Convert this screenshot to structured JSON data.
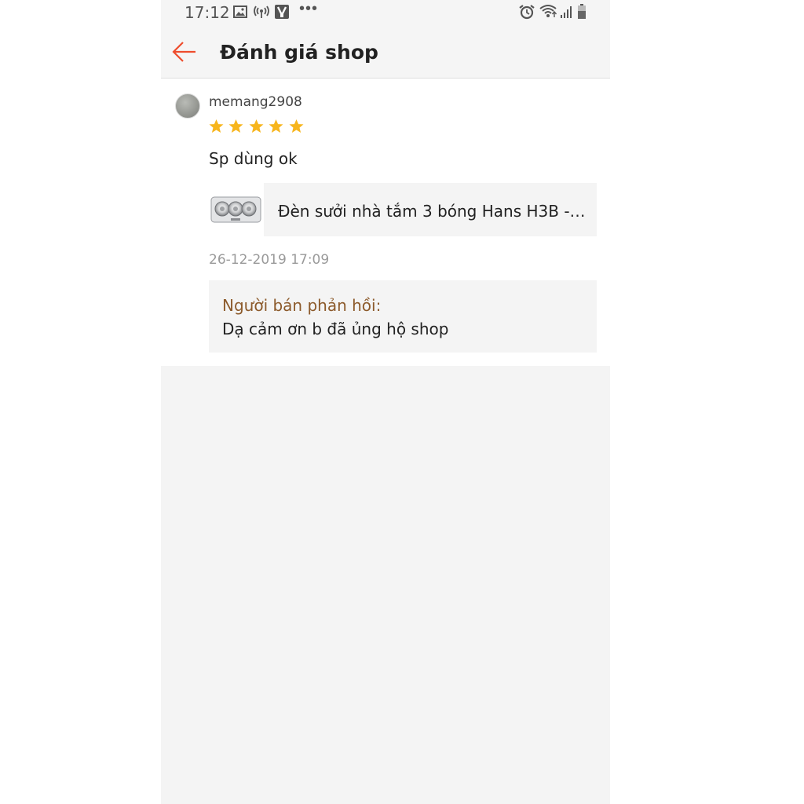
{
  "status_bar": {
    "time": "17:12",
    "left_icons": [
      "image-icon",
      "signal-broadcast-icon",
      "vpn-key-icon",
      "more-dots-icon"
    ],
    "more": "•••",
    "right_icons": [
      "alarm-icon",
      "wifi-icon",
      "cell-signal-icon",
      "battery-icon"
    ]
  },
  "header": {
    "back_icon": "arrow-left-icon",
    "title": "Đánh giá shop"
  },
  "review": {
    "username": "memang2908",
    "rating": 5,
    "rating_max": 5,
    "comment": "Sp dùng ok",
    "product_name": "Đèn sưởi nhà tắm 3 bóng Hans H3B - H…",
    "datetime": "26-12-2019 17:09",
    "seller_reply_label": "Người bán phản hồi:",
    "seller_reply_text": "Dạ cảm ơn b đã ủng hộ shop"
  },
  "colors": {
    "accent": "#ee4d2d",
    "star": "#f7b51c",
    "reply_label": "#8c5a2b"
  }
}
